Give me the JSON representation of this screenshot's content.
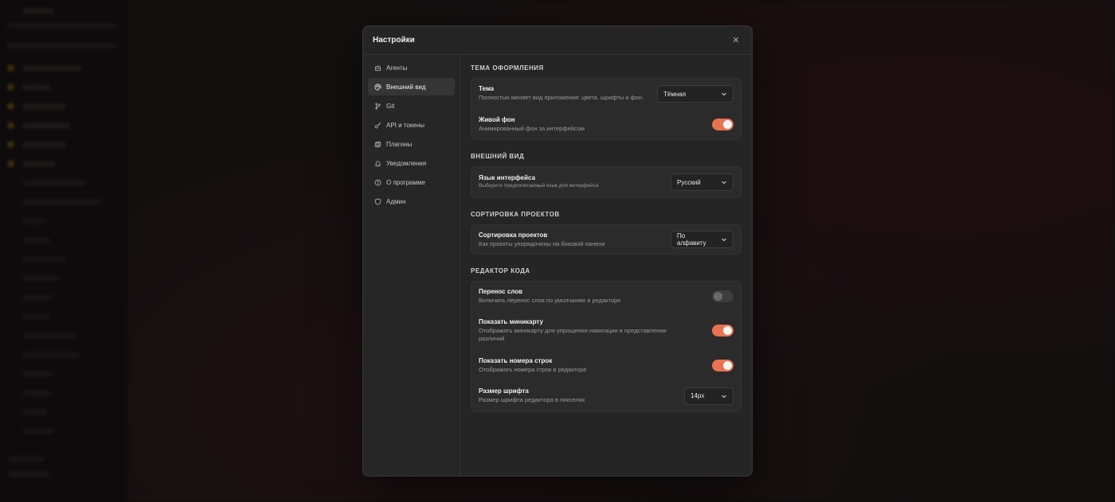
{
  "modal": {
    "title": "Настройки",
    "close_glyph": "✕"
  },
  "nav": {
    "items": [
      {
        "label": "Агенты",
        "icon": "bot-icon",
        "active": false
      },
      {
        "label": "Внешний вид",
        "icon": "palette-icon",
        "active": true
      },
      {
        "label": "Git",
        "icon": "git-branch-icon",
        "active": false
      },
      {
        "label": "API и токены",
        "icon": "key-icon",
        "active": false
      },
      {
        "label": "Плагины",
        "icon": "puzzle-icon",
        "active": false
      },
      {
        "label": "Уведомления",
        "icon": "bell-icon",
        "active": false
      },
      {
        "label": "О программе",
        "icon": "info-icon",
        "active": false
      },
      {
        "label": "Админ",
        "icon": "shield-icon",
        "active": false
      }
    ]
  },
  "sections": {
    "theme": {
      "title": "ТЕМА ОФОРМЛЕНИЯ",
      "theme_row": {
        "title": "Тема",
        "desc": "Полностью меняет вид приложения: цвета, шрифты и фон.",
        "value": "Тёмная"
      },
      "live_bg_row": {
        "title": "Живой фон",
        "desc": "Анимированный фон за интерфейсом",
        "enabled": true
      }
    },
    "appearance": {
      "title": "ВНЕШНИЙ ВИД",
      "lang_row": {
        "title": "Язык интерфейса",
        "desc": "Выберите предпочитаемый язык для интерфейса",
        "value": "Русский"
      }
    },
    "sorting": {
      "title": "СОРТИРОВКА ПРОЕКТОВ",
      "sort_row": {
        "title": "Сортировка проектов",
        "desc": "Как проекты упорядочены на боковой панели",
        "value": "По алфавиту"
      }
    },
    "editor": {
      "title": "РЕДАКТОР КОДА",
      "wrap_row": {
        "title": "Перенос слов",
        "desc": "Включить перенос слов по умолчанию в редакторе",
        "enabled": false
      },
      "minimap_row": {
        "title": "Показать миникарту",
        "desc": "Отображать миникарту для упрощения навигации в представлении различий",
        "enabled": true
      },
      "lines_row": {
        "title": "Показать номера строк",
        "desc": "Отображать номера строк в редакторе",
        "enabled": true
      },
      "font_row": {
        "title": "Размер шрифта",
        "desc": "Размер шрифта редактора в пикселях",
        "value": "14px"
      }
    }
  },
  "colors": {
    "accent": "#e8714f",
    "modal_bg": "#252525",
    "card_bg": "#2b2b2b"
  }
}
